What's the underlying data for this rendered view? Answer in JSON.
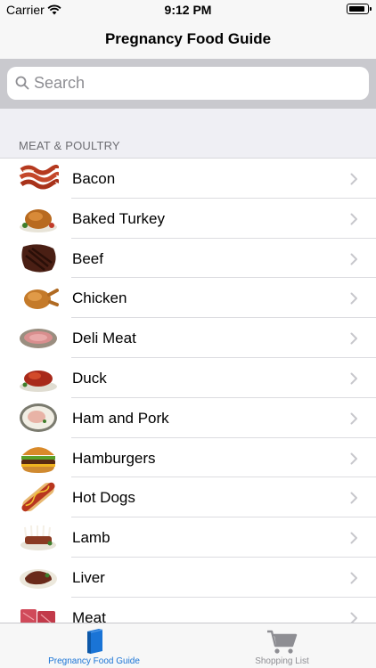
{
  "status_bar": {
    "carrier": "Carrier",
    "time": "9:12 PM",
    "battery_level": 0.9
  },
  "navbar": {
    "title": "Pregnancy Food Guide"
  },
  "search": {
    "placeholder": "Search",
    "value": ""
  },
  "section": {
    "header": "MEAT & POULTRY"
  },
  "list": {
    "items": [
      {
        "label": "Bacon",
        "icon": "bacon-icon"
      },
      {
        "label": "Baked Turkey",
        "icon": "turkey-icon"
      },
      {
        "label": "Beef",
        "icon": "beef-icon"
      },
      {
        "label": "Chicken",
        "icon": "chicken-icon"
      },
      {
        "label": "Deli Meat",
        "icon": "deli-meat-icon"
      },
      {
        "label": "Duck",
        "icon": "duck-icon"
      },
      {
        "label": "Ham and Pork",
        "icon": "ham-icon"
      },
      {
        "label": "Hamburgers",
        "icon": "hamburger-icon"
      },
      {
        "label": "Hot Dogs",
        "icon": "hot-dog-icon"
      },
      {
        "label": "Lamb",
        "icon": "lamb-icon"
      },
      {
        "label": "Liver",
        "icon": "liver-icon"
      },
      {
        "label": "Meat",
        "icon": "meat-icon"
      }
    ]
  },
  "tabbar": {
    "tabs": [
      {
        "label": "Pregnancy Food Guide",
        "icon": "book-icon",
        "active": true
      },
      {
        "label": "Shopping List",
        "icon": "cart-icon",
        "active": false
      }
    ]
  },
  "colors": {
    "accent": "#1a74d6",
    "inactive": "#8e8e93",
    "section_bg": "#efeff4",
    "search_bg": "#c9c9ce"
  }
}
